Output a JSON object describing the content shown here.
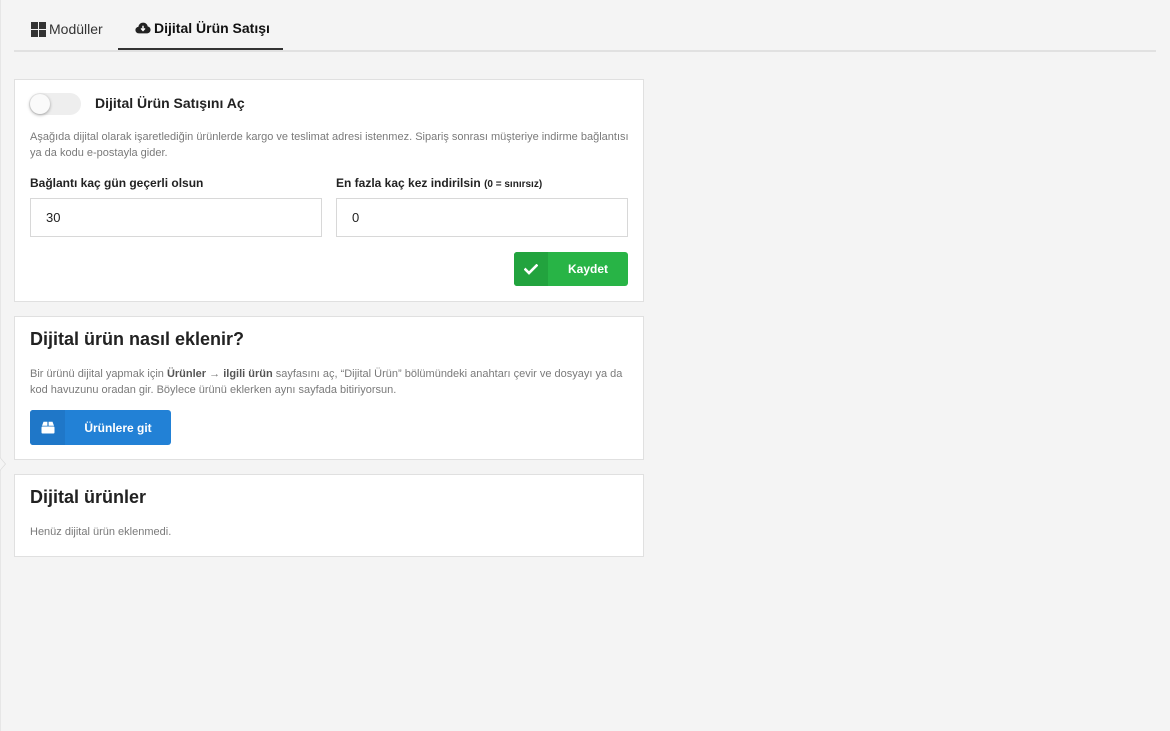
{
  "tabs": [
    {
      "label": "Modüller",
      "icon": "grid-icon"
    },
    {
      "label": "Dijital Ürün Satışı",
      "icon": "cloud-download-icon",
      "active": true
    }
  ],
  "settings": {
    "toggle_label": "Dijital Ürün Satışını Aç",
    "toggle_on": false,
    "description": "Aşağıda dijital olarak işaretlediğin ürünlerde kargo ve teslimat adresi istenmez. Sipariş sonrası müşteriye indirme bağlantısı ya da kodu e-postayla gider.",
    "days_label": "Bağlantı kaç gün geçerli olsun",
    "days_value": "30",
    "max_label": "En fazla kaç kez indirilsin",
    "max_hint": "(0 = sınırsız)",
    "max_value": "0",
    "save_label": "Kaydet"
  },
  "howto": {
    "title": "Dijital ürün nasıl eklenir?",
    "text_1": "Bir ürünü dijital yapmak için ",
    "bold_1": "Ürünler",
    "arrow": " → ",
    "bold_2": "ilgili ürün",
    "text_2": " sayfasını aç, “Dijital Ürün” bölümündeki anahtarı çevir ve dosyayı ya da kod havuzunu oradan gir. Böylece ürünü eklerken aynı sayfada bitiriyorsun.",
    "button_label": "Ürünlere git"
  },
  "products": {
    "title": "Dijital ürünler",
    "empty_text": "Henüz dijital ürün eklenmedi."
  },
  "colors": {
    "save_green": "#28b446",
    "primary_blue": "#2281d6",
    "page_bg": "#f4f4f4"
  }
}
